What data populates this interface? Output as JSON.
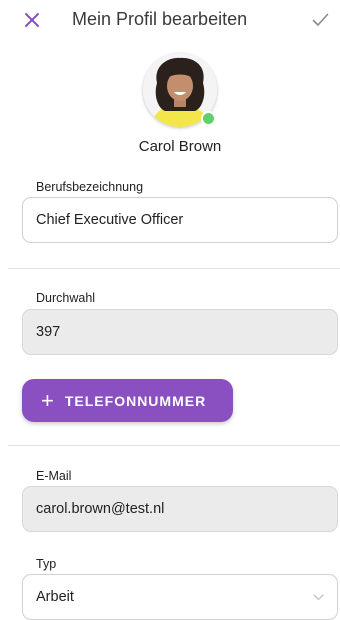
{
  "header": {
    "title": "Mein Profil bearbeiten",
    "close_icon": "close-icon",
    "confirm_icon": "check-icon"
  },
  "profile": {
    "name": "Carol Brown",
    "avatar": "profile-photo",
    "status": "online",
    "status_color": "#5fd068"
  },
  "job_title": {
    "label": "Berufsbezeichnung",
    "value": "Chief Executive Officer"
  },
  "extension": {
    "label": "Durchwahl",
    "value": "397"
  },
  "add_phone_button": {
    "icon": "plus-icon",
    "label": "TELEFONNUMMER"
  },
  "email": {
    "label": "E-Mail",
    "value": "carol.brown@test.nl"
  },
  "type": {
    "label": "Typ",
    "value": "Arbeit",
    "icon": "chevron-down-icon"
  },
  "colors": {
    "accent": "#8a4fc0",
    "field_readonly_bg": "#ebebeb"
  }
}
